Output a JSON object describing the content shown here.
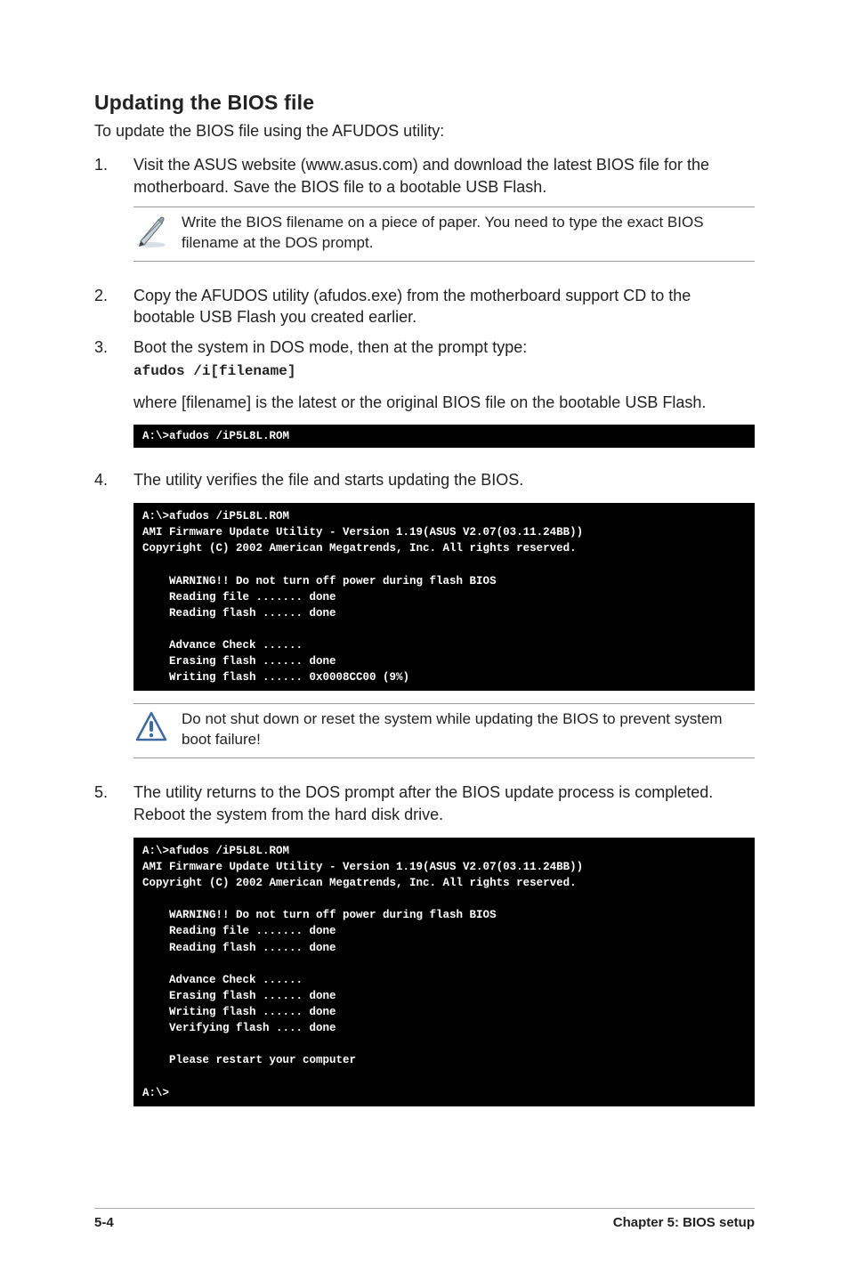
{
  "heading": "Updating the BIOS file",
  "intro": "To update the BIOS file using the AFUDOS utility:",
  "steps": {
    "s1_num": "1.",
    "s1": "Visit the ASUS website (www.asus.com) and download the latest BIOS file for the motherboard. Save the BIOS file to a bootable USB Flash.",
    "note1": "Write the BIOS filename on a piece of paper. You need to type the exact BIOS filename at the DOS prompt.",
    "s2_num": "2.",
    "s2": "Copy the AFUDOS utility (afudos.exe) from the motherboard support CD to the bootable USB Flash you created earlier.",
    "s3_num": "3.",
    "s3": "Boot the system in DOS mode, then at the prompt type:",
    "s3_cmd": "afudos /i[filename]",
    "s3_where": "where [filename] is the latest or the original BIOS file on the bootable USB Flash.",
    "term1": "A:\\>afudos /iP5L8L.ROM",
    "s4_num": "4.",
    "s4": "The utility verifies the file and starts updating the BIOS.",
    "term2": "A:\\>afudos /iP5L8L.ROM\nAMI Firmware Update Utility - Version 1.19(ASUS V2.07(03.11.24BB))\nCopyright (C) 2002 American Megatrends, Inc. All rights reserved.\n\n    WARNING!! Do not turn off power during flash BIOS\n    Reading file ....... done\n    Reading flash ...... done\n\n    Advance Check ......\n    Erasing flash ...... done\n    Writing flash ...... 0x0008CC00 (9%)",
    "note2": "Do not shut down or reset the system while updating the BIOS to prevent system boot failure!",
    "s5_num": "5.",
    "s5": "The utility returns to the DOS prompt after the BIOS update process is completed. Reboot the system from the hard disk drive.",
    "term3": "A:\\>afudos /iP5L8L.ROM\nAMI Firmware Update Utility - Version 1.19(ASUS V2.07(03.11.24BB))\nCopyright (C) 2002 American Megatrends, Inc. All rights reserved.\n\n    WARNING!! Do not turn off power during flash BIOS\n    Reading file ....... done\n    Reading flash ...... done\n\n    Advance Check ......\n    Erasing flash ...... done\n    Writing flash ...... done\n    Verifying flash .... done\n\n    Please restart your computer\n\nA:\\>"
  },
  "footer": {
    "page": "5-4",
    "chapter": "Chapter 5: BIOS setup"
  }
}
